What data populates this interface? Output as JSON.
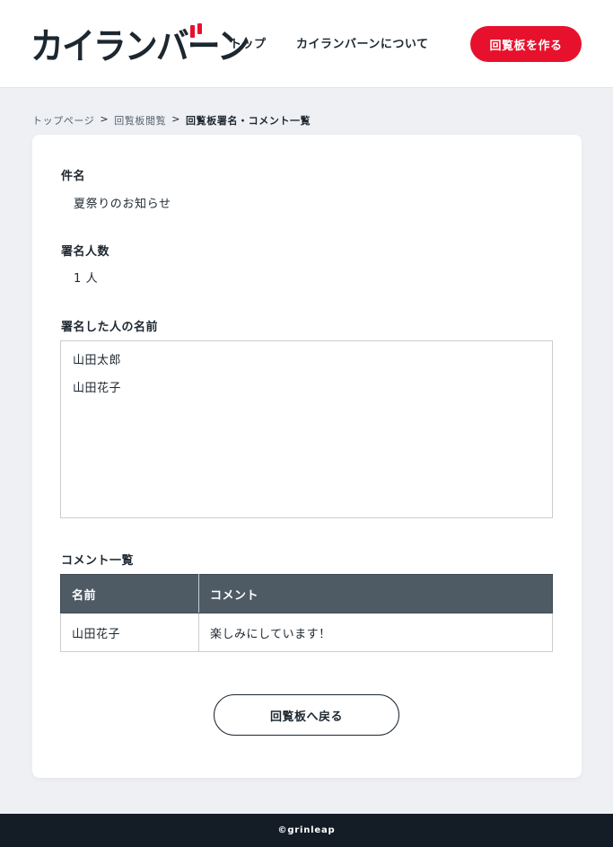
{
  "header": {
    "logo": "カイランバーン",
    "nav": [
      {
        "label": "トップ"
      },
      {
        "label": "カイランバーンについて"
      }
    ],
    "create_button": "回覧板を作る",
    "accent_color": "#e8112d"
  },
  "breadcrumb": {
    "items": [
      "トップページ",
      "回覧板閲覧",
      "回覧板署名・コメント一覧"
    ],
    "separator": ">"
  },
  "detail": {
    "subject_label": "件名",
    "subject_value": "夏祭りのお知らせ",
    "signers_count_label": "署名人数",
    "signers_count_value": "1 人",
    "signers_label": "署名した人の名前",
    "signers": [
      "山田太郎",
      "山田花子"
    ]
  },
  "comments": {
    "heading": "コメント一覧",
    "columns": [
      "名前",
      "コメント"
    ],
    "rows": [
      {
        "name": "山田花子",
        "comment": "楽しみにしています！"
      }
    ]
  },
  "back_button": "回覧板へ戻る",
  "footer": {
    "copyright": "©grinleap"
  }
}
